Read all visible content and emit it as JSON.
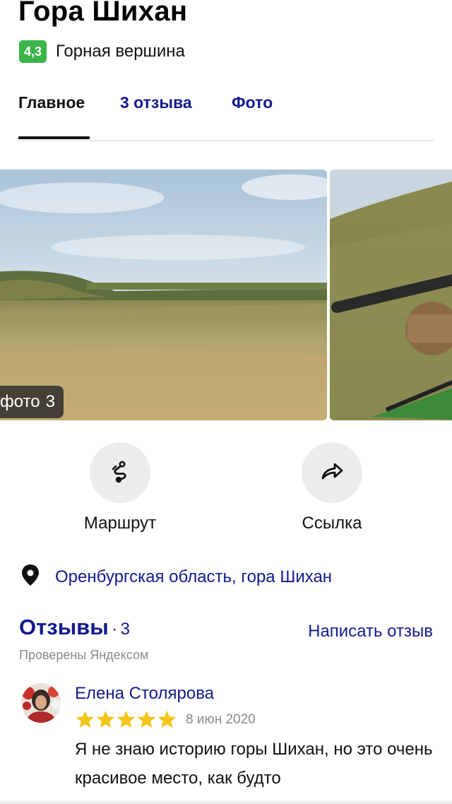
{
  "place": {
    "title": "Гора Шихан",
    "rating": "4,3",
    "category": "Горная вершина"
  },
  "tabs": [
    {
      "label": "Главное",
      "active": true
    },
    {
      "label": "3 отзыва",
      "active": false
    },
    {
      "label": "Фото",
      "active": false
    }
  ],
  "photos": {
    "badge_label": "фото",
    "badge_count": "3"
  },
  "actions": {
    "route_label": "Маршрут",
    "route_icon": "route-icon",
    "share_label": "Ссылка",
    "share_icon": "share-arrow-icon"
  },
  "address": {
    "icon": "location-pin-icon",
    "text": "Оренбургская область, гора Шихан"
  },
  "reviews": {
    "title": "Отзывы",
    "separator": "·",
    "count": "3",
    "write_label": "Написать отзыв",
    "verified_note": "Проверены Яндексом",
    "items": [
      {
        "author": "Елена Столярова",
        "stars": 5,
        "date": "8 июн 2020",
        "text": "Я не знаю историю горы Шихан, но это очень красивое место, как будто"
      }
    ]
  },
  "colors": {
    "accent": "#141a8c",
    "rating_badge": "#3bb54a",
    "star": "#f5c518"
  }
}
